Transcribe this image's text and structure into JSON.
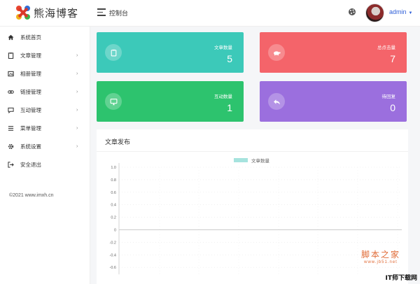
{
  "header": {
    "logo_text": "熊海博客",
    "console_label": "控制台",
    "user_name": "admin",
    "caret": "▼"
  },
  "sidebar": {
    "items": [
      {
        "label": "系统首页",
        "icon": "home-icon",
        "chevron": ""
      },
      {
        "label": "文章管理",
        "icon": "document-icon",
        "chevron": "›"
      },
      {
        "label": "相册管理",
        "icon": "gallery-icon",
        "chevron": "›"
      },
      {
        "label": "链接管理",
        "icon": "link-icon",
        "chevron": "›"
      },
      {
        "label": "互动管理",
        "icon": "comment-icon",
        "chevron": "›"
      },
      {
        "label": "菜单管理",
        "icon": "menu-icon",
        "chevron": "›"
      },
      {
        "label": "系统设置",
        "icon": "gear-icon",
        "chevron": "›"
      },
      {
        "label": "安全退出",
        "icon": "logout-icon",
        "chevron": ""
      }
    ],
    "copyright": "©2021 www.imxh.cn"
  },
  "cards": [
    {
      "title": "文章数量",
      "value": "5",
      "color": "#3cc9b9",
      "icon": "clipboard-icon"
    },
    {
      "title": "总点击量",
      "value": "7",
      "color": "#f4646a",
      "icon": "turtle-icon"
    },
    {
      "title": "互动数量",
      "value": "1",
      "color": "#2dc36e",
      "icon": "monitor-icon"
    },
    {
      "title": "待回复",
      "value": "0",
      "color": "#9b6fde",
      "icon": "reply-icon"
    }
  ],
  "chart_panel": {
    "title": "文章发布"
  },
  "chart_data": {
    "type": "line",
    "title": "",
    "xlabel": "",
    "ylabel": "",
    "series": [
      {
        "name": "文章数量",
        "values": [],
        "color": "#a6e3de"
      }
    ],
    "yticks": [
      "1.0",
      "0.8",
      "0.6",
      "0.4",
      "0.2",
      "0",
      "-0.2",
      "-0.4",
      "-0.6"
    ],
    "ylim": [
      -0.6,
      1.0
    ],
    "grid": true,
    "legend": "top-center"
  },
  "watermark": {
    "main": "脚本之家",
    "sub": "www.jb51.net",
    "corner": "IT师下载网"
  }
}
